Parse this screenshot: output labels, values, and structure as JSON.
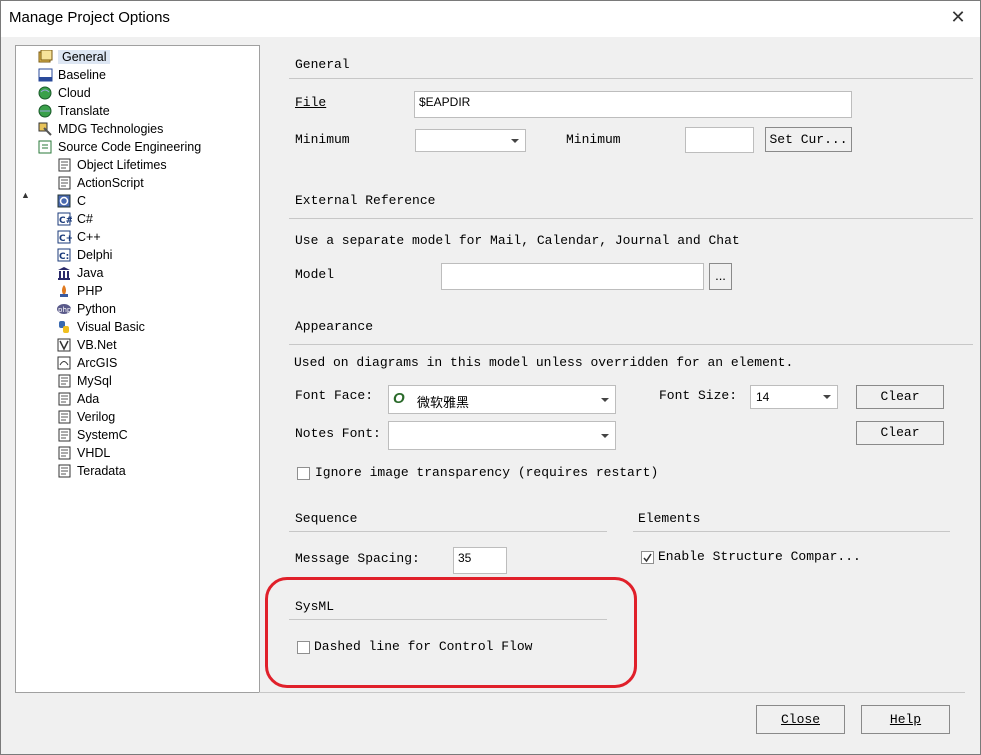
{
  "window": {
    "title": "Manage Project Options",
    "close_glyph": "✕"
  },
  "tree": {
    "items": [
      {
        "label": "General",
        "icon": "general-icon"
      },
      {
        "label": "Baseline",
        "icon": "baseline-icon"
      },
      {
        "label": "Cloud",
        "icon": "cloud-icon"
      },
      {
        "label": "Translate",
        "icon": "translate-icon"
      },
      {
        "label": "MDG Technologies",
        "icon": "mdg-icon"
      },
      {
        "label": "Source Code Engineering",
        "icon": "source-code-icon"
      },
      {
        "label": "Object Lifetimes",
        "icon": "object-lifetimes-icon"
      },
      {
        "label": "ActionScript",
        "icon": "actionscript-icon"
      },
      {
        "label": "C",
        "icon": "c-icon"
      },
      {
        "label": "C#",
        "icon": "csharp-icon"
      },
      {
        "label": "C++",
        "icon": "cpp-icon"
      },
      {
        "label": "Delphi",
        "icon": "delphi-icon"
      },
      {
        "label": "Java",
        "icon": "java-icon"
      },
      {
        "label": "PHP",
        "icon": "php-icon"
      },
      {
        "label": "Python",
        "icon": "python-icon"
      },
      {
        "label": "Visual Basic",
        "icon": "visual-basic-icon"
      },
      {
        "label": "VB.Net",
        "icon": "vbnet-icon"
      },
      {
        "label": "ArcGIS",
        "icon": "arcgis-icon"
      },
      {
        "label": "MySql",
        "icon": "mysql-icon"
      },
      {
        "label": "Ada",
        "icon": "ada-icon"
      },
      {
        "label": "Verilog",
        "icon": "verilog-icon"
      },
      {
        "label": "SystemC",
        "icon": "systemc-icon"
      },
      {
        "label": "VHDL",
        "icon": "vhdl-icon"
      },
      {
        "label": "Teradata",
        "icon": "teradata-icon"
      }
    ]
  },
  "general": {
    "heading": "General",
    "file_label": "File",
    "file_value": "$EAPDIR",
    "minimum_label_1": "Minimum",
    "minimum_label_2": "Minimum",
    "set_current": "Set Cur..."
  },
  "external_ref": {
    "heading": "External Reference",
    "note": "Use a separate model for Mail, Calendar, Journal and Chat",
    "model_label": "Model",
    "browse": "..."
  },
  "appearance": {
    "heading": "Appearance",
    "note": "Used on diagrams in this model unless overridden for an element.",
    "font_face_label": "Font Face:",
    "font_face_value": "微软雅黑",
    "font_size_label": "Font Size:",
    "font_size_value": "14",
    "clear_1": "Clear",
    "notes_font_label": "Notes Font:",
    "clear_2": "Clear",
    "ignore_transparency": "Ignore image transparency (requires restart)"
  },
  "sequence": {
    "heading": "Sequence",
    "spacing_label": "Message Spacing:",
    "spacing_value": "35"
  },
  "elements": {
    "heading": "Elements",
    "structure_compare": "Enable Structure Compar..."
  },
  "sysml": {
    "heading": "SysML",
    "dashed_line": "Dashed line for Control Flow"
  },
  "footer": {
    "close": "Close",
    "help": "Help"
  },
  "colors": {
    "highlight_ring": "#e0202a",
    "selection": "#dde6f3"
  }
}
